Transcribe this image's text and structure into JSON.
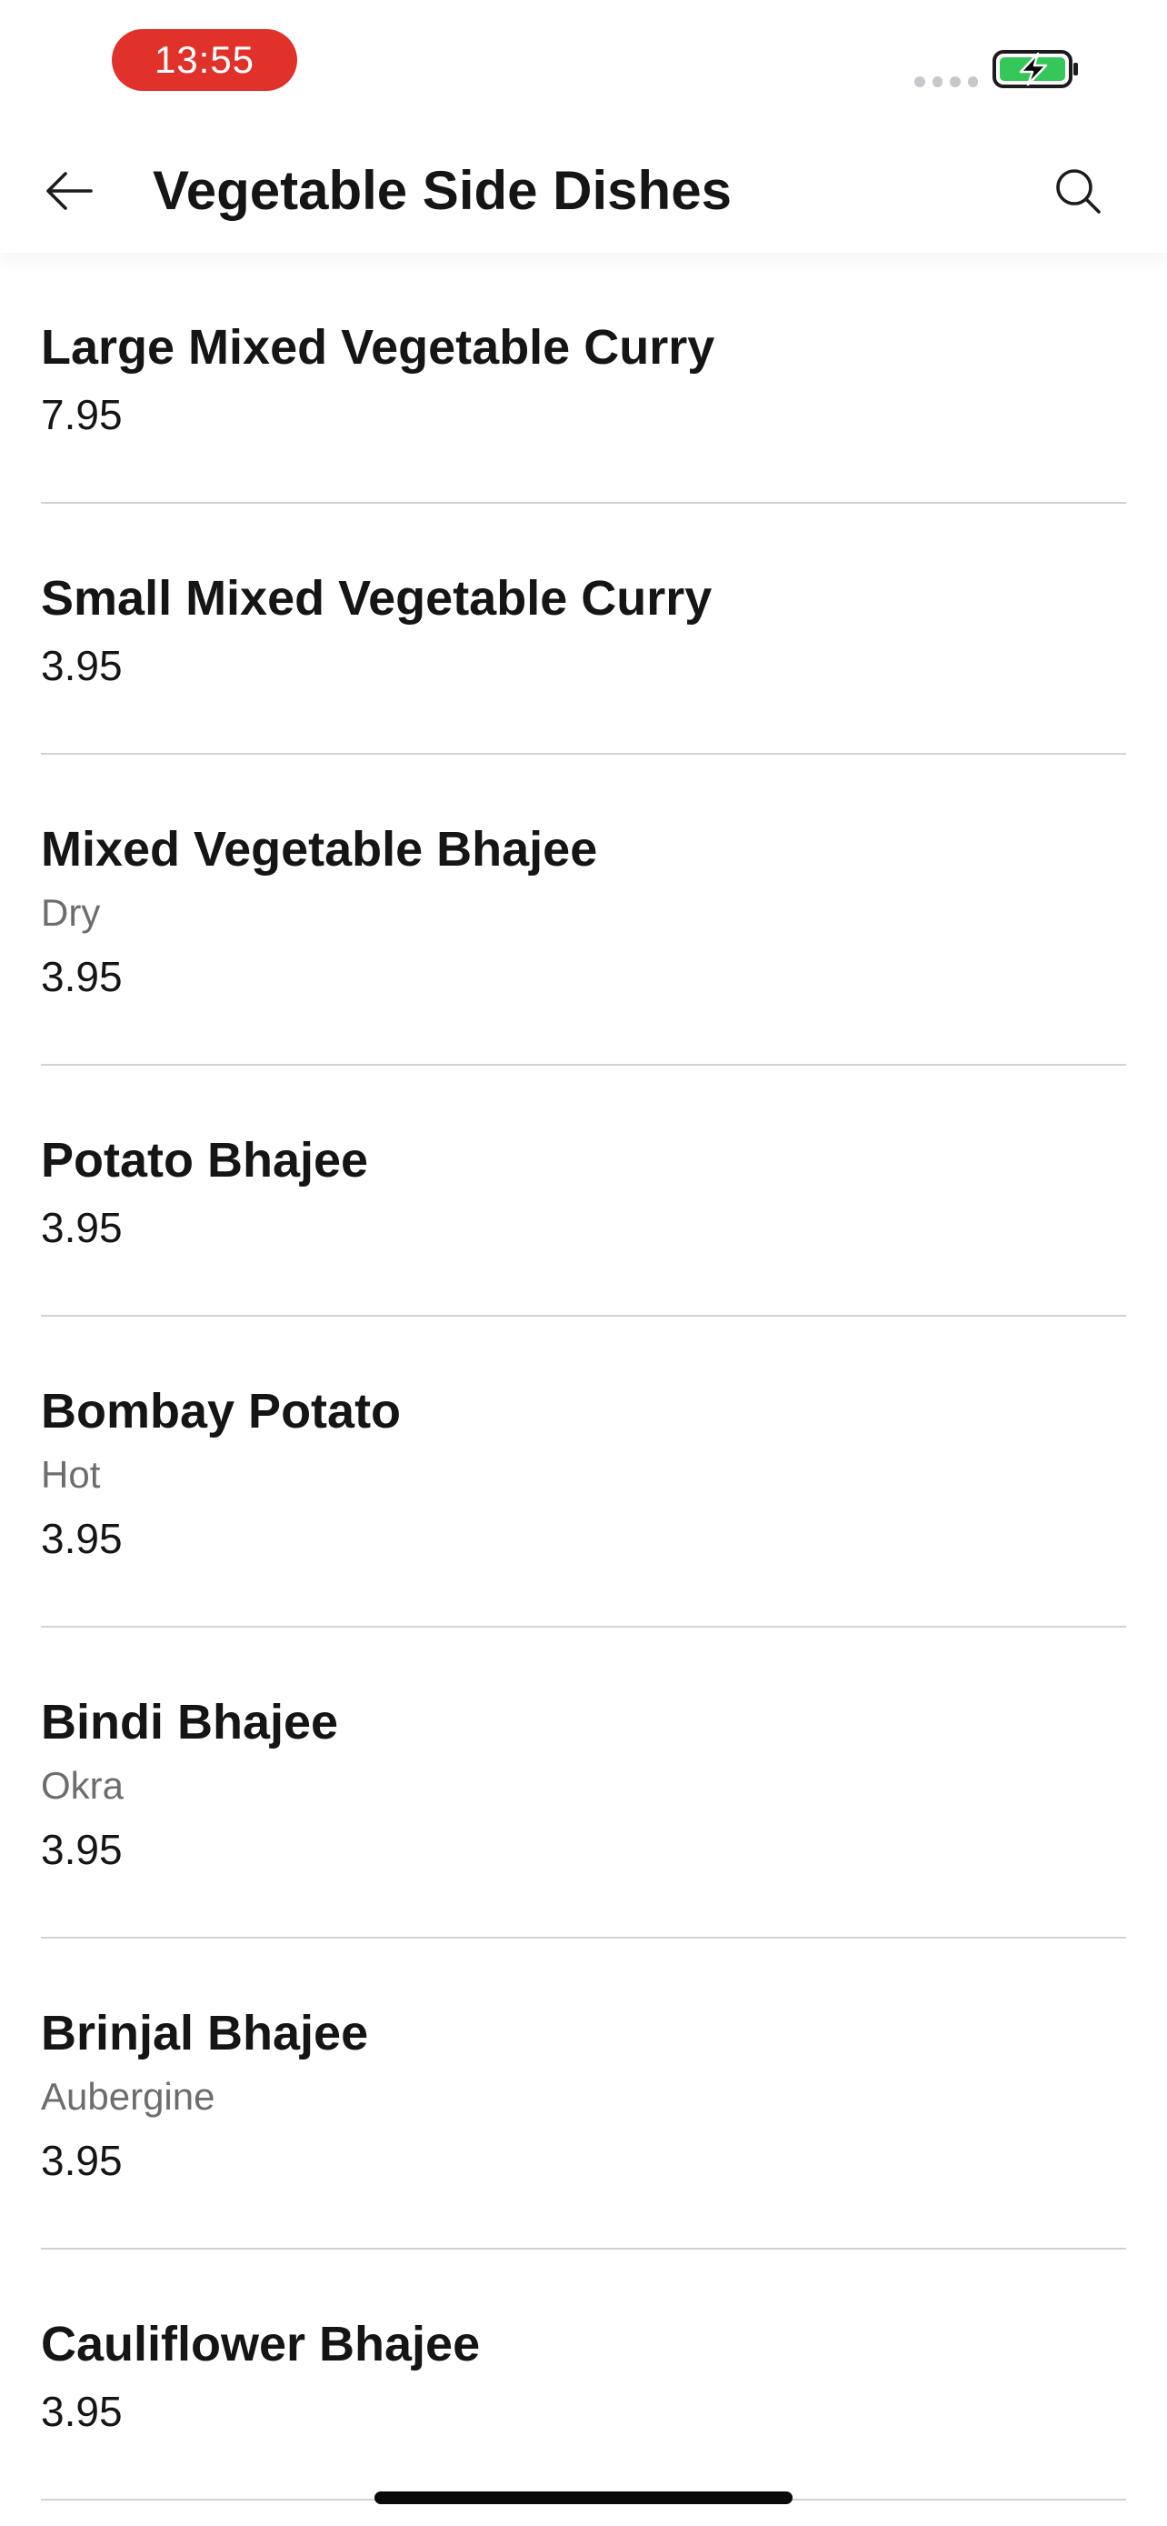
{
  "status_bar": {
    "time": "13:55",
    "time_pill_color": "#e0322b",
    "battery_color": "#35c759",
    "battery_state": "charging"
  },
  "nav": {
    "title": "Vegetable Side Dishes",
    "back_icon": "arrow-left-icon",
    "search_icon": "search-icon"
  },
  "menu_items": [
    {
      "name": "Large Mixed Vegetable Curry",
      "description": "",
      "price": "7.95"
    },
    {
      "name": "Small Mixed Vegetable Curry",
      "description": "",
      "price": "3.95"
    },
    {
      "name": "Mixed Vegetable Bhajee",
      "description": "Dry",
      "price": "3.95"
    },
    {
      "name": "Potato Bhajee",
      "description": "",
      "price": "3.95"
    },
    {
      "name": "Bombay Potato",
      "description": "Hot",
      "price": "3.95"
    },
    {
      "name": "Bindi Bhajee",
      "description": "Okra",
      "price": "3.95"
    },
    {
      "name": "Brinjal Bhajee",
      "description": "Aubergine",
      "price": "3.95"
    },
    {
      "name": "Cauliflower Bhajee",
      "description": "",
      "price": "3.95"
    }
  ]
}
